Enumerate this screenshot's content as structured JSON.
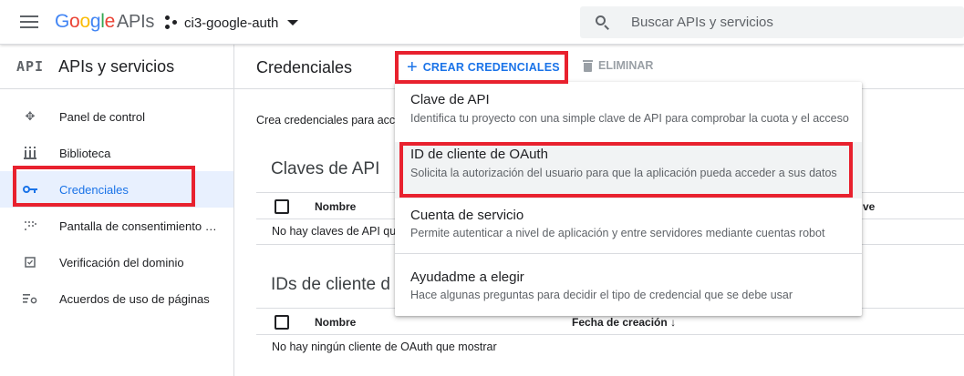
{
  "header": {
    "logo": {
      "letters": [
        "G",
        "o",
        "o",
        "g",
        "l",
        "e"
      ],
      "suffix": "APIs"
    },
    "project": "ci3-google-auth",
    "search_placeholder": "Buscar APIs y servicios"
  },
  "sidebar": {
    "glyph": "API",
    "title": "APIs y servicios",
    "items": [
      {
        "label": "Panel de control",
        "icon": "dashboard-icon"
      },
      {
        "label": "Biblioteca",
        "icon": "library-icon"
      },
      {
        "label": "Credenciales",
        "icon": "key-icon",
        "active": true
      },
      {
        "label": "Pantalla de consentimiento …",
        "icon": "consent-icon"
      },
      {
        "label": "Verificación del dominio",
        "icon": "domain-check-icon"
      },
      {
        "label": "Acuerdos de uso de páginas",
        "icon": "settings-list-icon"
      }
    ]
  },
  "main": {
    "title": "Credenciales",
    "create_label": "CREAR CREDENCIALES",
    "delete_label": "ELIMINAR",
    "intro": "Crea credenciales para acc",
    "api_keys": {
      "title": "Claves de API",
      "col_name": "Nombre",
      "col_key_tail": "ve",
      "empty": "No hay claves de API qu"
    },
    "oauth": {
      "title": "IDs de cliente d",
      "col_name": "Nombre",
      "col_date": "Fecha de creación",
      "empty": "No hay ningún cliente de OAuth que mostrar"
    }
  },
  "menu": {
    "items": [
      {
        "title": "Clave de API",
        "desc": "Identifica tu proyecto con una simple clave de API para comprobar la cuota y el acceso"
      },
      {
        "title": "ID de cliente de OAuth",
        "desc": "Solicita la autorización del usuario para que la aplicación pueda acceder a sus datos"
      },
      {
        "title": "Cuenta de servicio",
        "desc": "Permite autenticar a nivel de aplicación y entre servidores mediante cuentas robot"
      },
      {
        "title": "Ayudadme a elegir",
        "desc": "Hace algunas preguntas para decidir el tipo de credencial que se debe usar"
      }
    ]
  },
  "colors": {
    "accent": "#1a73e8",
    "highlight": "#e8212e",
    "active_bg": "#e8f0fe"
  }
}
